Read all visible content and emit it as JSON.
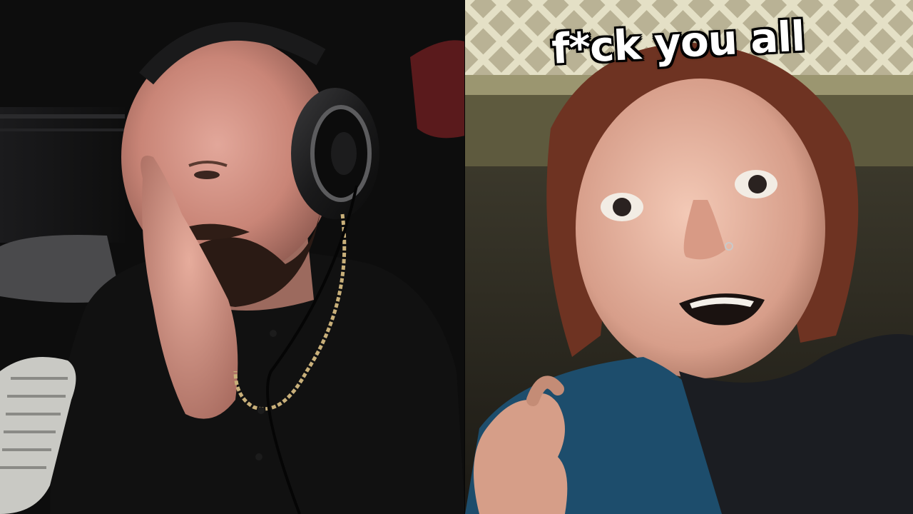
{
  "video": {
    "caption_text": "f*ck you all"
  },
  "colors": {
    "left_background": "#0d0d0d",
    "right_background": "#2a261c",
    "caption_fill": "#ffffff",
    "caption_outline": "#000000"
  }
}
